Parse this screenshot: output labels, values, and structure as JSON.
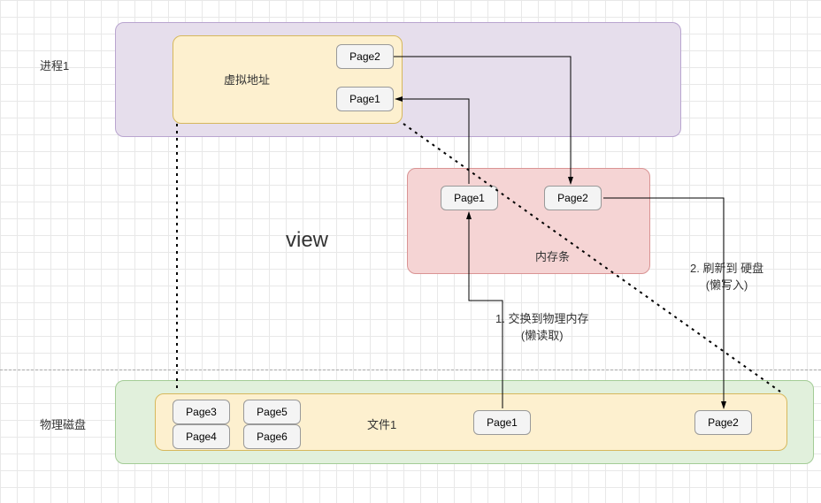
{
  "labels": {
    "process": "进程1",
    "virtual_addr": "虚拟地址",
    "memory": "内存条",
    "disk": "物理磁盘",
    "file": "文件1",
    "view": "view"
  },
  "pages": {
    "virt_p2": "Page2",
    "virt_p1": "Page1",
    "mem_p1": "Page1",
    "mem_p2": "Page2",
    "file_p3": "Page3",
    "file_p4": "Page4",
    "file_p5": "Page5",
    "file_p6": "Page6",
    "file_p1": "Page1",
    "file_p2": "Page2"
  },
  "annotations": {
    "step1_line1": "1. 交换到物理内存",
    "step1_line2": "(懒读取)",
    "step2_line1": "2. 刷新到 硬盘",
    "step2_line2": "(懒写入)"
  }
}
